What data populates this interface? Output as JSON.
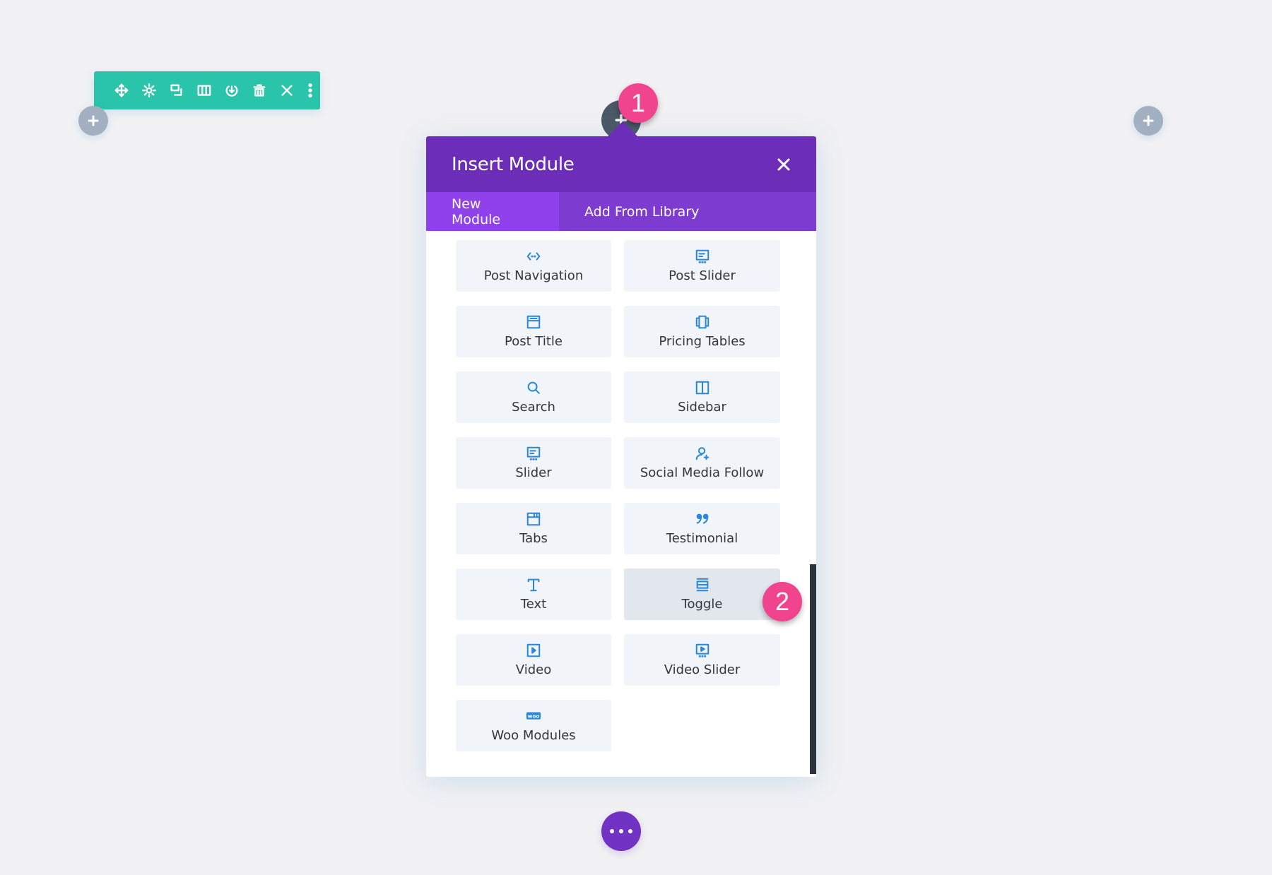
{
  "row_toolbar": {
    "icons": [
      "move-icon",
      "settings-icon",
      "duplicate-icon",
      "columns-icon",
      "save-to-library-icon",
      "delete-icon",
      "close-icon",
      "more-icon"
    ]
  },
  "modal": {
    "title": "Insert Module",
    "tabs": [
      {
        "label": "New Module",
        "active": true
      },
      {
        "label": "Add From Library",
        "active": false
      }
    ],
    "modules": [
      {
        "label": "Post Navigation",
        "icon": "post-navigation-icon"
      },
      {
        "label": "Post Slider",
        "icon": "post-slider-icon"
      },
      {
        "label": "Post Title",
        "icon": "post-title-icon"
      },
      {
        "label": "Pricing Tables",
        "icon": "pricing-tables-icon"
      },
      {
        "label": "Search",
        "icon": "search-icon"
      },
      {
        "label": "Sidebar",
        "icon": "sidebar-icon"
      },
      {
        "label": "Slider",
        "icon": "slider-icon"
      },
      {
        "label": "Social Media Follow",
        "icon": "social-media-follow-icon"
      },
      {
        "label": "Tabs",
        "icon": "tabs-icon"
      },
      {
        "label": "Testimonial",
        "icon": "testimonial-icon"
      },
      {
        "label": "Text",
        "icon": "text-icon"
      },
      {
        "label": "Toggle",
        "icon": "toggle-icon",
        "hovered": true
      },
      {
        "label": "Video",
        "icon": "video-icon"
      },
      {
        "label": "Video Slider",
        "icon": "video-slider-icon"
      },
      {
        "label": "Woo Modules",
        "icon": "woo-icon"
      }
    ]
  },
  "badges": {
    "step1": "1",
    "step2": "2"
  },
  "colors": {
    "toolbar": "#29c4a9",
    "header": "#6c2eb9",
    "tab_bar": "#7e3bd0",
    "tab_active": "#8f42ec",
    "icon": "#2b87da",
    "badge": "#f0448f",
    "more_button": "#7133c4"
  }
}
